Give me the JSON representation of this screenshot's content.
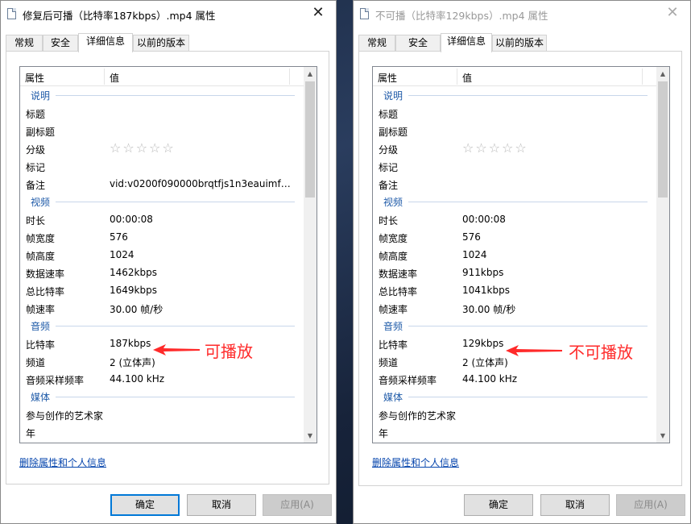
{
  "common": {
    "tabs": [
      "常规",
      "安全",
      "详细信息",
      "以前的版本"
    ],
    "active_tab": "详细信息",
    "column_name": "属性",
    "column_value": "值",
    "remove_link": "删除属性和个人信息",
    "ok_button": "确定",
    "cancel_button": "取消",
    "apply_button": "应用(A)",
    "close_glyph": "✕",
    "scroll_up_glyph": "▲",
    "scroll_down_glyph": "▼",
    "rating_stars": "☆☆☆☆☆",
    "colors": {
      "annotation": "#ff2a2a",
      "group_header": "#1e5aa8",
      "default_button_border": "#0078d7",
      "link": "#0645ad"
    }
  },
  "left": {
    "title": "修复后可播（比特率187kbps）.mp4 属性",
    "window_state": "active",
    "groups": {
      "description": {
        "label": "说明",
        "rows": [
          {
            "name": "标题",
            "value": ""
          },
          {
            "name": "副标题",
            "value": ""
          },
          {
            "name": "分级",
            "value": "☆☆☆☆☆",
            "rating": true
          },
          {
            "name": "标记",
            "value": ""
          },
          {
            "name": "备注",
            "value": "vid:v0200f090000brqtfjs1n3eauimfh..."
          }
        ]
      },
      "video": {
        "label": "视频",
        "rows": [
          {
            "name": "时长",
            "value": "00:00:08"
          },
          {
            "name": "帧宽度",
            "value": "576"
          },
          {
            "name": "帧高度",
            "value": "1024"
          },
          {
            "name": "数据速率",
            "value": "1462kbps"
          },
          {
            "name": "总比特率",
            "value": "1649kbps"
          },
          {
            "name": "帧速率",
            "value": "30.00 帧/秒"
          }
        ]
      },
      "audio": {
        "label": "音频",
        "rows": [
          {
            "name": "比特率",
            "value": "187kbps"
          },
          {
            "name": "频道",
            "value": "2 (立体声)"
          },
          {
            "name": "音频采样频率",
            "value": "44.100 kHz"
          }
        ]
      },
      "media": {
        "label": "媒体",
        "rows": [
          {
            "name": "参与创作的艺术家",
            "value": ""
          },
          {
            "name": "年",
            "value": ""
          }
        ]
      }
    },
    "annotation": "可播放"
  },
  "right": {
    "title": "不可播（比特率129kbps）.mp4 属性",
    "window_state": "inactive",
    "groups": {
      "description": {
        "label": "说明",
        "rows": [
          {
            "name": "标题",
            "value": ""
          },
          {
            "name": "副标题",
            "value": ""
          },
          {
            "name": "分级",
            "value": "☆☆☆☆☆",
            "rating": true
          },
          {
            "name": "标记",
            "value": ""
          },
          {
            "name": "备注",
            "value": ""
          }
        ]
      },
      "video": {
        "label": "视频",
        "rows": [
          {
            "name": "时长",
            "value": "00:00:08"
          },
          {
            "name": "帧宽度",
            "value": "576"
          },
          {
            "name": "帧高度",
            "value": "1024"
          },
          {
            "name": "数据速率",
            "value": "911kbps"
          },
          {
            "name": "总比特率",
            "value": "1041kbps"
          },
          {
            "name": "帧速率",
            "value": "30.00 帧/秒"
          }
        ]
      },
      "audio": {
        "label": "音频",
        "rows": [
          {
            "name": "比特率",
            "value": "129kbps"
          },
          {
            "name": "频道",
            "value": "2 (立体声)"
          },
          {
            "name": "音频采样频率",
            "value": "44.100 kHz"
          }
        ]
      },
      "media": {
        "label": "媒体",
        "rows": [
          {
            "name": "参与创作的艺术家",
            "value": ""
          },
          {
            "name": "年",
            "value": ""
          }
        ]
      }
    },
    "annotation": "不可播放"
  }
}
